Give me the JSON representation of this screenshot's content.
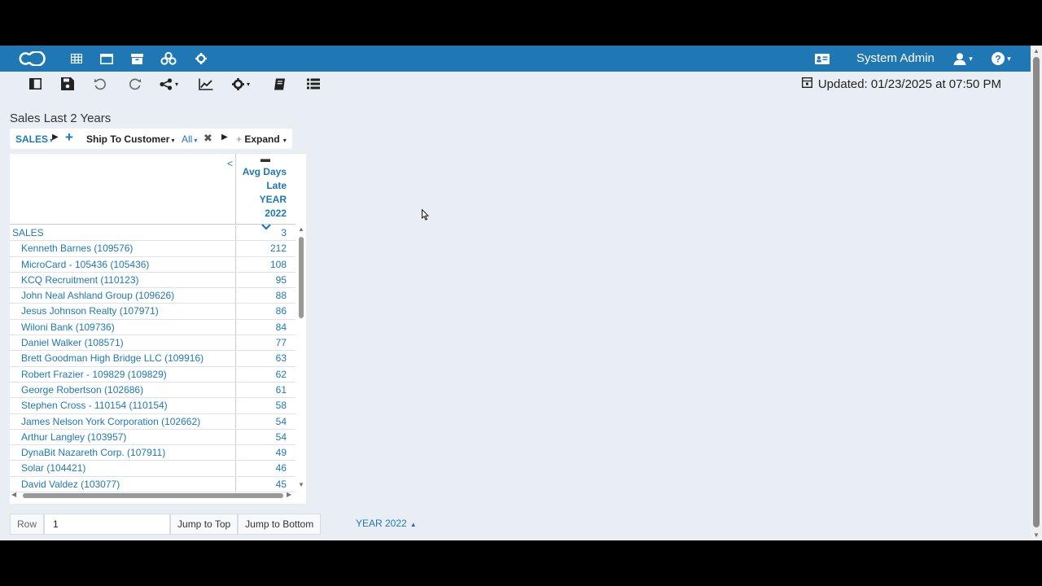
{
  "nav": {
    "user_name": "System Admin",
    "icons": [
      "logo-icon",
      "grid-icon",
      "window-icon",
      "archive-icon",
      "cogs-icon",
      "gear-icon",
      "id-card-icon",
      "user-icon",
      "help-icon"
    ]
  },
  "toolbar": {
    "updated_text": "Updated: 01/23/2025 at 07:50 PM"
  },
  "page": {
    "title": "Sales Last 2 Years"
  },
  "pivot": {
    "measure": "SALES",
    "dimension": "Ship To Customer",
    "filter": "All",
    "expand": "Expand"
  },
  "grid": {
    "column_header": {
      "line1": "Avg Days",
      "line2": "Late",
      "line3": "YEAR 2022"
    },
    "total": {
      "label": "SALES",
      "value": "3"
    },
    "rows": [
      {
        "label": "Kenneth Barnes (109576)",
        "value": "212"
      },
      {
        "label": "MicroCard - 105436 (105436)",
        "value": "108"
      },
      {
        "label": "KCQ Recruitment (110123)",
        "value": "95"
      },
      {
        "label": "John Neal Ashland Group (109626)",
        "value": "88"
      },
      {
        "label": "Jesus Johnson Realty (107971)",
        "value": "86"
      },
      {
        "label": "Wiloni Bank (109736)",
        "value": "84"
      },
      {
        "label": "Daniel Walker (108571)",
        "value": "77"
      },
      {
        "label": "Brett Goodman High Bridge LLC (109916)",
        "value": "63"
      },
      {
        "label": "Robert Frazier - 109829 (109829)",
        "value": "62"
      },
      {
        "label": "George Robertson (102686)",
        "value": "61"
      },
      {
        "label": "Stephen Cross - 110154 (110154)",
        "value": "58"
      },
      {
        "label": "James Nelson York Corporation (102662)",
        "value": "54"
      },
      {
        "label": "Arthur Langley (103957)",
        "value": "54"
      },
      {
        "label": "DynaBit Nazareth Corp. (107911)",
        "value": "49"
      },
      {
        "label": "Solar (104421)",
        "value": "46"
      },
      {
        "label": "David Valdez (103077)",
        "value": "45"
      }
    ]
  },
  "footer": {
    "row_label": "Row",
    "row_value": "1",
    "jump_top": "Jump to Top",
    "jump_bottom": "Jump to Bottom",
    "year_tab": "YEAR 2022"
  }
}
